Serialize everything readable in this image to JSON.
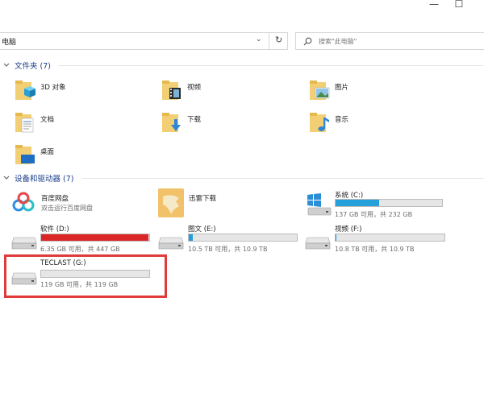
{
  "window": {
    "minimize": "—",
    "maximize": "☐"
  },
  "address": {
    "path": "电脑",
    "dropdown": "⌄",
    "refresh": "↻"
  },
  "search": {
    "placeholder": "搜索\"此电脑\""
  },
  "groups": {
    "folders": {
      "title": "文件夹 (7)",
      "expanded": true
    },
    "devices": {
      "title": "设备和驱动器 (7)",
      "expanded": true
    }
  },
  "folders": [
    {
      "label": "3D 对象",
      "icon": "3d-objects-icon"
    },
    {
      "label": "视频",
      "icon": "video-folder-icon"
    },
    {
      "label": "图片",
      "icon": "pictures-folder-icon"
    },
    {
      "label": "文档",
      "icon": "documents-folder-icon"
    },
    {
      "label": "下载",
      "icon": "downloads-folder-icon"
    },
    {
      "label": "音乐",
      "icon": "music-folder-icon"
    },
    {
      "label": "桌面",
      "icon": "desktop-folder-icon"
    }
  ],
  "apps": [
    {
      "name": "百度网盘",
      "subtitle": "双击运行百度网盘",
      "icon": "baidu-netdisk-icon"
    },
    {
      "name": "迅雷下载",
      "icon": "xunlei-icon"
    }
  ],
  "drives": [
    {
      "name": "系统 (C:)",
      "info": "137 GB 可用，共 232 GB",
      "used_fraction": 0.41,
      "warn": false,
      "icon": "windows-drive-icon"
    },
    {
      "name": "软件 (D:)",
      "info": "6.35 GB 可用，共 447 GB",
      "used_fraction": 0.99,
      "warn": true,
      "icon": "hard-drive-icon"
    },
    {
      "name": "图文 (E:)",
      "info": "10.5 TB 可用，共 10.9 TB",
      "used_fraction": 0.04,
      "warn": false,
      "icon": "hard-drive-icon"
    },
    {
      "name": "视频 (F:)",
      "info": "10.8 TB 可用，共 10.9 TB",
      "used_fraction": 0.01,
      "warn": false,
      "icon": "hard-drive-icon"
    },
    {
      "name": "TECLAST (G:)",
      "info": "119 GB 可用，共 119 GB",
      "used_fraction": 0.0,
      "warn": false,
      "icon": "hard-drive-icon"
    }
  ],
  "colors": {
    "accent": "#26a0da",
    "warn": "#da2626",
    "highlight": "#e03a3a",
    "group_header": "#1a3d8a"
  }
}
